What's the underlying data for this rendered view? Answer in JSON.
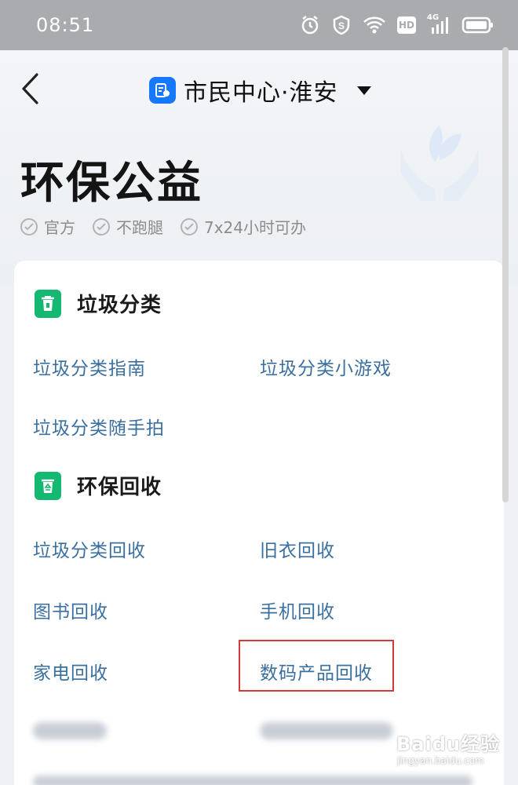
{
  "status_bar": {
    "time": "08:51",
    "icons": [
      "alarm-icon",
      "shield-s-icon",
      "wifi-icon",
      "hd-icon",
      "signal-4g-icon",
      "battery-icon"
    ],
    "hd_label": "HD",
    "network_label": "4G"
  },
  "nav": {
    "back_icon": "chevron-left-icon",
    "city_title": "市民中心·淮安",
    "dropdown_icon": "caret-down-icon"
  },
  "page": {
    "title": "环保公益",
    "tags": [
      "官方",
      "不跑腿",
      "7x24小时可办"
    ]
  },
  "sections": [
    {
      "title": "垃圾分类",
      "icon": "trash-bin-icon",
      "items": [
        "垃圾分类指南",
        "垃圾分类小游戏",
        "垃圾分类随手拍"
      ]
    },
    {
      "title": "环保回收",
      "icon": "recycle-bin-icon",
      "items": [
        "垃圾分类回收",
        "旧衣回收",
        "图书回收",
        "手机回收",
        "家电回收",
        "数码产品回收"
      ]
    }
  ],
  "highlighted_item": "数码产品回收",
  "watermark": {
    "brand": "Baidu经验",
    "url": "jingyan.baidu.com"
  },
  "colors": {
    "accent_green": "#14b870",
    "link_blue": "#3a6fa0",
    "highlight_red": "#d33a35",
    "badge_blue": "#1677ff"
  }
}
